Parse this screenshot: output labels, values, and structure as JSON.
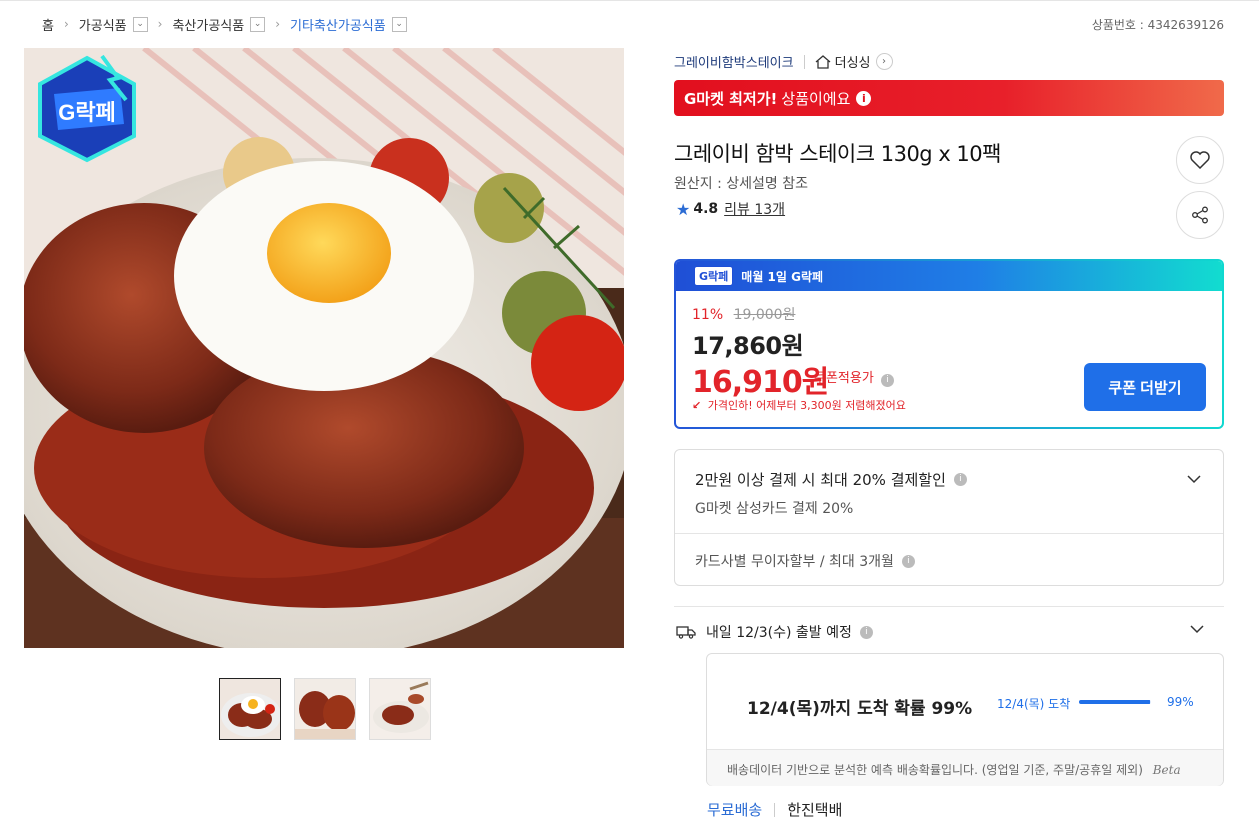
{
  "breadcrumb": {
    "home": "홈",
    "level1": "가공식품",
    "level2": "축산가공식품",
    "level3": "기타축산가공식품"
  },
  "product_number": "상품번호 : 4342639126",
  "gallery": {
    "badge_text": "G락페",
    "thumbnail_count": 3,
    "selected_thumbnail": 1
  },
  "brand": {
    "name": "그레이비함박스테이크",
    "store": "더싱싱"
  },
  "promo_banner": {
    "bold": "G마켓 최저가!",
    "text": "상품이에요"
  },
  "product": {
    "title": "그레이비 함박 스테이크 130g x 10팩",
    "origin": "원산지 : 상세설명 참조",
    "rating": "4.8",
    "reviews": "리뷰 13개"
  },
  "price_box": {
    "header_badge": "G락페",
    "header_text": "매월 1일 G락페",
    "discount_pct": "11%",
    "original_price": "19,000원",
    "sale_price": "17,860원",
    "coupon_price": "16,910원",
    "coupon_label": "쿠폰적용가",
    "price_drop": "가격인하! 어제부터 3,300원 저렴해졌어요",
    "coupon_button": "쿠폰 더받기"
  },
  "card_benefit": {
    "title": "2만원 이상 결제 시 최대 20% 결제할인",
    "subtitle": "G마켓 삼성카드 결제 20%",
    "installment": "카드사별 무이자할부 / 최대 3개월"
  },
  "shipping": {
    "departure": "내일 12/3(수) 출발 예정",
    "probability_title": "12/4(목)까지 도착 확률 99%",
    "probability_label": "12/4(목) 도착",
    "probability_value": 0.99,
    "probability_pct": "99%",
    "note": "배송데이터 기반으로 분석한 예측 배송확률입니다. (영업일 기준, 주말/공휴일 제외)",
    "beta": "Beta",
    "fee": "무료배송",
    "carrier": "한진택배"
  },
  "colors": {
    "accent_blue": "#1f6fe8",
    "sale_red": "#e2242a",
    "brand_navy": "#1d3a7a"
  }
}
